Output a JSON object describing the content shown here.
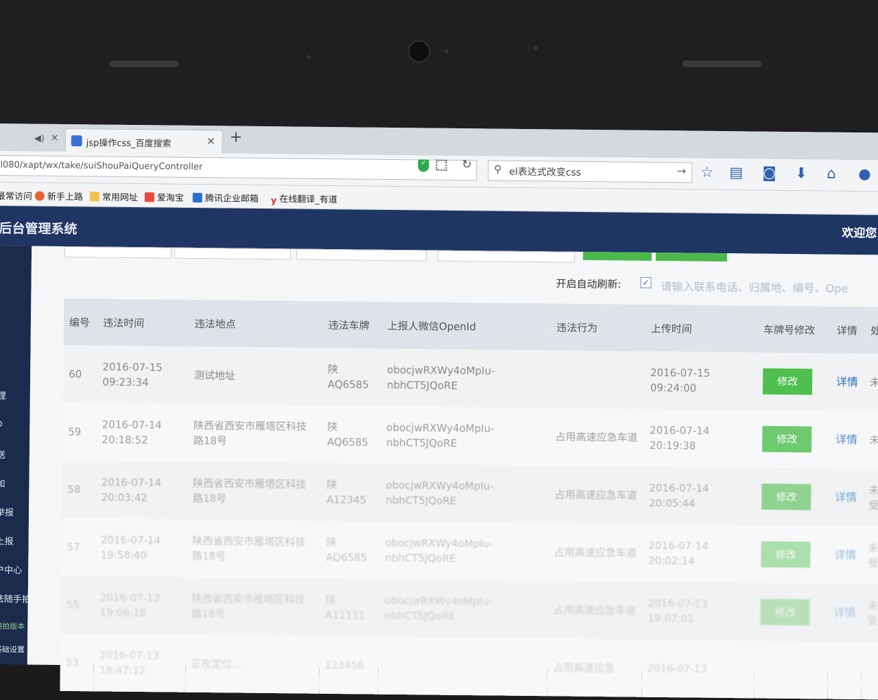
{
  "browser": {
    "tab_title": "jsp操作css_百度搜索",
    "tab_close": "×",
    "new_tab": "+",
    "url": "l080/xapt/wx/take/suiShouPaiQueryController",
    "search_value": "el表达式改变css"
  },
  "bookmarks": [
    {
      "label": "最常访问",
      "color": ""
    },
    {
      "label": "新手上路",
      "color": "#e8622c"
    },
    {
      "label": "常用网址",
      "color": "#f2c14e"
    },
    {
      "label": "爱淘宝",
      "color": "#e84c3d"
    },
    {
      "label": "腾讯企业邮箱",
      "color": "#2e6fd1"
    },
    {
      "label": "在线翻译_有道",
      "color": "#d33"
    }
  ],
  "app": {
    "title": "后台管理系统",
    "welcome": "欢迎您"
  },
  "sidebar": {
    "items": [
      "理",
      "b",
      "送",
      "加",
      "举报",
      "上报",
      "户中心",
      "法随手拍",
      "随拍版本",
      "基础设置"
    ]
  },
  "toolbar": {
    "auto_refresh_label": "开启自动刷新:",
    "auto_refresh_checked": true,
    "filter_placeholder": "请输入联系电话、归属地、编号、Ope"
  },
  "table": {
    "columns": [
      "编号",
      "违法时间",
      "违法地点",
      "违法车牌",
      "上报人微信OpenId",
      "违法行为",
      "上传时间",
      "车牌号修改",
      "详情",
      "处"
    ],
    "rows": [
      {
        "id": "60",
        "time": "2016-07-15 09:23:34",
        "place": "测试地址",
        "plate": "陕AQ6585",
        "openid": "obocjwRXWy4oMpIu-nbhCT5JQoRE",
        "behavior": "",
        "upload": "2016-07-15 09:24:00",
        "edit": "修改",
        "detail": "详情",
        "status": "未"
      },
      {
        "id": "59",
        "time": "2016-07-14 20:18:52",
        "place": "陕西省西安市雁塔区科技路18号",
        "plate": "陕AQ6585",
        "openid": "obocjwRXWy4oMpIu-nbhCT5JQoRE",
        "behavior": "占用高速应急车道",
        "upload": "2016-07-14 20:19:38",
        "edit": "修改",
        "detail": "详情",
        "status": "未"
      },
      {
        "id": "58",
        "time": "2016-07-14 20:03:42",
        "place": "陕西省西安市雁塔区科技路18号",
        "plate": "陕A12345",
        "openid": "obocjwRXWy4oMpIu-nbhCT5JQoRE",
        "behavior": "占用高速应急车道",
        "upload": "2016-07-14 20:05:44",
        "edit": "修改",
        "detail": "详情",
        "status": "未受"
      },
      {
        "id": "57",
        "time": "2016-07-14 19:58:40",
        "place": "陕西省西安市雁塔区科技路18号",
        "plate": "陕AQ6585",
        "openid": "obocjwRXWy4oMpIu-nbhCT5JQoRE",
        "behavior": "占用高速应急车道",
        "upload": "2016-07-14 20:02:14",
        "edit": "修改",
        "detail": "详情",
        "status": "未受"
      },
      {
        "id": "55",
        "time": "2016-07-13 19:06:18",
        "place": "陕西省西安市雁塔区科技路18号",
        "plate": "陕A11111",
        "openid": "obocjwRXWy4oMpIu-nbhCT5JQoRE",
        "behavior": "占用高速应急车道",
        "upload": "2016-07-13 19:07:01",
        "edit": "修改",
        "detail": "详情",
        "status": "未受"
      },
      {
        "id": "53",
        "time": "2016-07-13 18:47:12",
        "place": "正在定位...",
        "plate": "123456",
        "openid": "",
        "behavior": "占用高速应急",
        "upload": "2016-07-13",
        "edit": "",
        "detail": "",
        "status": ""
      }
    ]
  }
}
